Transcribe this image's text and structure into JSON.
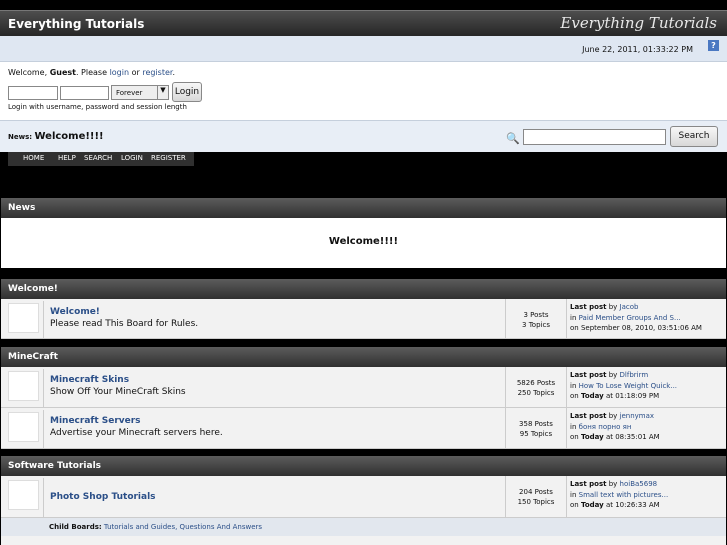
{
  "header": {
    "title": "Everything Tutorials",
    "logo_text": "Everything Tutorials"
  },
  "datebar": {
    "datetime": "June 22, 2011, 01:33:22 PM",
    "help_icon": "help-icon"
  },
  "user_panel": {
    "welcome_prefix": "Welcome,",
    "guest": "Guest",
    "please": ". Please",
    "login_link": "login",
    "or": "or",
    "register_link": "register",
    "period": ".",
    "session_option": "Forever",
    "login_button": "Login",
    "hint": "Login with username, password and session length"
  },
  "newsbar": {
    "label": "News:",
    "headline": "Welcome!!!!",
    "search_button": "Search",
    "search_icon": "magnifier-icon"
  },
  "menu": [
    "HOME",
    "HELP",
    "SEARCH",
    "LOGIN",
    "REGISTER"
  ],
  "news_section": {
    "title": "News",
    "content": "Welcome!!!!"
  },
  "categories": [
    {
      "title": "Welcome!"
    },
    {
      "title": "MineCraft"
    },
    {
      "title": "Software Tutorials"
    }
  ],
  "boards": [
    {
      "name": "Welcome!",
      "desc": "Please read This Board for Rules.",
      "posts": "3 Posts",
      "topics": "3 Topics",
      "last_label": "Last post",
      "by": "by",
      "user": "Jacob",
      "in": "in",
      "topic": "Paid Member Groups And S...",
      "on": "on September 08, 2010, 03:51:06 AM"
    },
    {
      "name": "Minecraft Skins",
      "desc": "Show Off Your MineCraft Skins",
      "posts": "5826 Posts",
      "topics": "250 Topics",
      "last_label": "Last post",
      "by": "by",
      "user": "Dlfbrirm",
      "in": "in",
      "topic": "How To Lose Weight Quick...",
      "on_prefix": "on",
      "on_today": "Today",
      "on_time": "at 01:18:09 PM"
    },
    {
      "name": "Minecraft Servers",
      "desc": "Advertise your Minecraft servers here.",
      "posts": "358 Posts",
      "topics": "95 Topics",
      "last_label": "Last post",
      "by": "by",
      "user": "jennymax",
      "in": "in",
      "topic": "боня порно ян",
      "on_prefix": "on",
      "on_today": "Today",
      "on_time": "at 08:35:01 AM"
    },
    {
      "name": "Photo Shop Tutorials",
      "desc": "",
      "posts": "204 Posts",
      "topics": "150 Topics",
      "last_label": "Last post",
      "by": "by",
      "user": "hoiBa5698",
      "in": "in",
      "topic": "Small text with pictures...",
      "on_prefix": "on",
      "on_today": "Today",
      "on_time": "at 10:26:33 AM"
    }
  ],
  "child_boards": {
    "label": "Child Boards:",
    "links": "Tutorials and Guides, Questions And Answers"
  }
}
